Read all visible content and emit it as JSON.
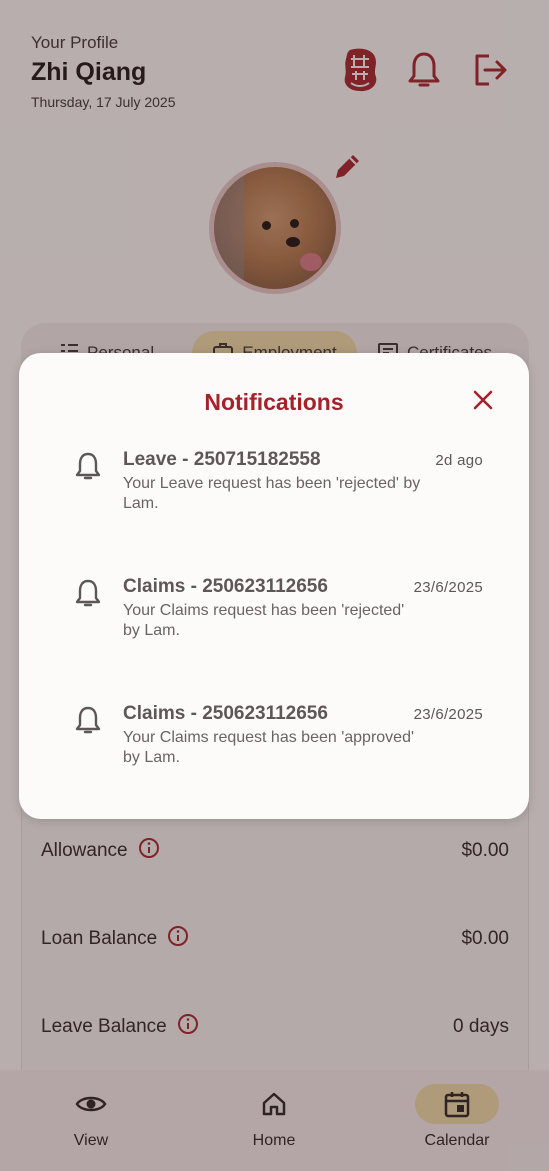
{
  "header": {
    "subtitle": "Your Profile",
    "name": "Zhi Qiang",
    "date": "Thursday, 17 July 2025"
  },
  "tabs": [
    {
      "label": "Personal",
      "icon": "list-icon"
    },
    {
      "label": "Employment",
      "icon": "briefcase-icon"
    },
    {
      "label": "Certificates",
      "icon": "certificate-icon"
    }
  ],
  "rows": [
    {
      "label": "Allowance",
      "value": "$0.00"
    },
    {
      "label": "Loan Balance",
      "value": "$0.00"
    },
    {
      "label": "Leave Balance",
      "value": "0 days"
    }
  ],
  "nav": [
    {
      "label": "View",
      "icon": "eye-icon"
    },
    {
      "label": "Home",
      "icon": "home-icon"
    },
    {
      "label": "Calendar",
      "icon": "calendar-icon"
    }
  ],
  "modal": {
    "title": "Notifications",
    "items": [
      {
        "title": "Leave - 250715182558",
        "time": "2d ago",
        "body": "Your Leave request has been 'rejected' by Lam."
      },
      {
        "title": "Claims - 250623112656",
        "time": "23/6/2025",
        "body": "Your Claims request has been 'rejected' by Lam."
      },
      {
        "title": "Claims - 250623112656",
        "time": "23/6/2025",
        "body": "Your Claims request has been 'approved' by Lam."
      }
    ]
  },
  "colors": {
    "accent": "#a5222a",
    "tab_active": "#f0dca8"
  }
}
